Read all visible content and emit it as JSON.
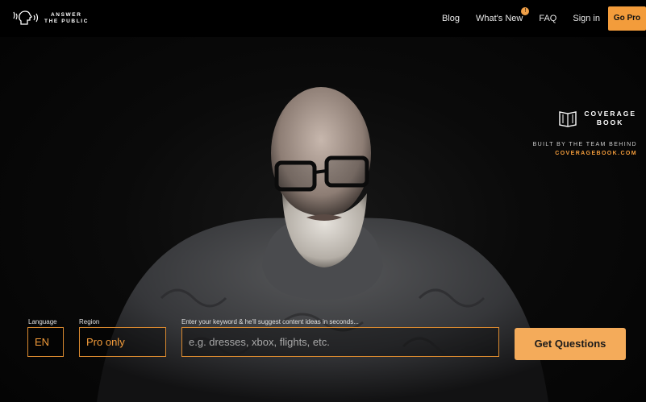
{
  "brand": {
    "logo_line1": "ANSWER",
    "logo_line2": "THE PUBLIC"
  },
  "nav": {
    "items": [
      "Blog",
      "What's New",
      "FAQ",
      "Sign in"
    ],
    "badge": "!",
    "go_pro": "Go Pro"
  },
  "coverage": {
    "title_line1": "COVERAGE",
    "title_line2": "BOOK",
    "built_by": "BUILT BY THE TEAM BEHIND",
    "url": "COVERAGEBOOK.COM"
  },
  "search": {
    "language_label": "Language",
    "language_value": "EN",
    "region_label": "Region",
    "region_value": "Pro only",
    "keyword_label": "Enter your keyword & he'll suggest content ideas in seconds...",
    "keyword_placeholder": "e.g. dresses, xbox, flights, etc.",
    "submit": "Get Questions"
  },
  "colors": {
    "accent": "#f39c3b",
    "button": "#f4ab5a",
    "background": "#050505"
  },
  "icons": [
    "head-speaking-icon",
    "book-icon"
  ]
}
